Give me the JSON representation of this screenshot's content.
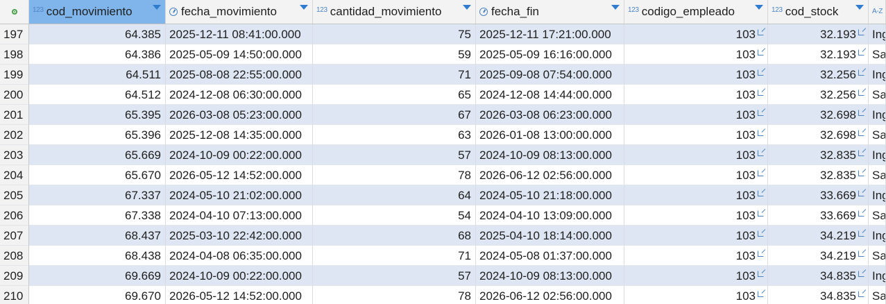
{
  "columns": [
    {
      "label": "cod_movimiento",
      "type_glyph": "123",
      "sorted": true
    },
    {
      "label": "fecha_movimiento",
      "type_glyph": "clock",
      "sorted": true
    },
    {
      "label": "cantidad_movimiento",
      "type_glyph": "123",
      "sorted": true
    },
    {
      "label": "fecha_fin",
      "type_glyph": "clock",
      "sorted": true
    },
    {
      "label": "codigo_empleado",
      "type_glyph": "123",
      "sorted": true
    },
    {
      "label": "cod_stock",
      "type_glyph": "123",
      "sorted": true
    },
    {
      "label": "",
      "type_glyph": "A-Z",
      "sorted": false
    }
  ],
  "rows": [
    {
      "n": "197",
      "cod_movimiento": "64.385",
      "fecha_movimiento": "2025-12-11 08:41:00.000",
      "cantidad_movimiento": "75",
      "fecha_fin": "2025-12-11 17:21:00.000",
      "codigo_empleado": "103",
      "cod_stock": "32.193",
      "extra": "Ing"
    },
    {
      "n": "198",
      "cod_movimiento": "64.386",
      "fecha_movimiento": "2025-05-09 14:50:00.000",
      "cantidad_movimiento": "59",
      "fecha_fin": "2025-05-09 16:16:00.000",
      "codigo_empleado": "103",
      "cod_stock": "32.193",
      "extra": "Sa"
    },
    {
      "n": "199",
      "cod_movimiento": "64.511",
      "fecha_movimiento": "2025-08-08 22:55:00.000",
      "cantidad_movimiento": "71",
      "fecha_fin": "2025-09-08 07:54:00.000",
      "codigo_empleado": "103",
      "cod_stock": "32.256",
      "extra": "Ing"
    },
    {
      "n": "200",
      "cod_movimiento": "64.512",
      "fecha_movimiento": "2024-12-08 06:30:00.000",
      "cantidad_movimiento": "65",
      "fecha_fin": "2024-12-08 14:44:00.000",
      "codigo_empleado": "103",
      "cod_stock": "32.256",
      "extra": "Sa"
    },
    {
      "n": "201",
      "cod_movimiento": "65.395",
      "fecha_movimiento": "2026-03-08 05:23:00.000",
      "cantidad_movimiento": "67",
      "fecha_fin": "2026-03-08 06:23:00.000",
      "codigo_empleado": "103",
      "cod_stock": "32.698",
      "extra": "Ing"
    },
    {
      "n": "202",
      "cod_movimiento": "65.396",
      "fecha_movimiento": "2025-12-08 14:35:00.000",
      "cantidad_movimiento": "63",
      "fecha_fin": "2026-01-08 13:00:00.000",
      "codigo_empleado": "103",
      "cod_stock": "32.698",
      "extra": "Sa"
    },
    {
      "n": "203",
      "cod_movimiento": "65.669",
      "fecha_movimiento": "2024-10-09 00:22:00.000",
      "cantidad_movimiento": "57",
      "fecha_fin": "2024-10-09 08:13:00.000",
      "codigo_empleado": "103",
      "cod_stock": "32.835",
      "extra": "Ing"
    },
    {
      "n": "204",
      "cod_movimiento": "65.670",
      "fecha_movimiento": "2026-05-12 14:52:00.000",
      "cantidad_movimiento": "78",
      "fecha_fin": "2026-06-12 02:56:00.000",
      "codigo_empleado": "103",
      "cod_stock": "32.835",
      "extra": "Sa"
    },
    {
      "n": "205",
      "cod_movimiento": "67.337",
      "fecha_movimiento": "2024-05-10 21:02:00.000",
      "cantidad_movimiento": "64",
      "fecha_fin": "2024-05-10 21:18:00.000",
      "codigo_empleado": "103",
      "cod_stock": "33.669",
      "extra": "Ing"
    },
    {
      "n": "206",
      "cod_movimiento": "67.338",
      "fecha_movimiento": "2024-04-10 07:13:00.000",
      "cantidad_movimiento": "54",
      "fecha_fin": "2024-04-10 13:09:00.000",
      "codigo_empleado": "103",
      "cod_stock": "33.669",
      "extra": "Sa"
    },
    {
      "n": "207",
      "cod_movimiento": "68.437",
      "fecha_movimiento": "2025-03-10 22:42:00.000",
      "cantidad_movimiento": "68",
      "fecha_fin": "2025-04-10 18:14:00.000",
      "codigo_empleado": "103",
      "cod_stock": "34.219",
      "extra": "Ing"
    },
    {
      "n": "208",
      "cod_movimiento": "68.438",
      "fecha_movimiento": "2024-04-08 06:35:00.000",
      "cantidad_movimiento": "71",
      "fecha_fin": "2024-05-08 01:37:00.000",
      "codigo_empleado": "103",
      "cod_stock": "34.219",
      "extra": "Sa"
    },
    {
      "n": "209",
      "cod_movimiento": "69.669",
      "fecha_movimiento": "2024-10-09 00:22:00.000",
      "cantidad_movimiento": "57",
      "fecha_fin": "2024-10-09 08:13:00.000",
      "codigo_empleado": "103",
      "cod_stock": "34.835",
      "extra": "Ing"
    },
    {
      "n": "210",
      "cod_movimiento": "69.670",
      "fecha_movimiento": "2026-05-12 14:52:00.000",
      "cantidad_movimiento": "78",
      "fecha_fin": "2026-06-12 02:56:00.000",
      "codigo_empleado": "103",
      "cod_stock": "34.835",
      "extra": "Sa"
    }
  ],
  "colors": {
    "selected_header": "#7fb5ea",
    "row_band": "#dde6f2",
    "icon_blue": "#4a84c4",
    "status_dot": "#4aa04a"
  }
}
